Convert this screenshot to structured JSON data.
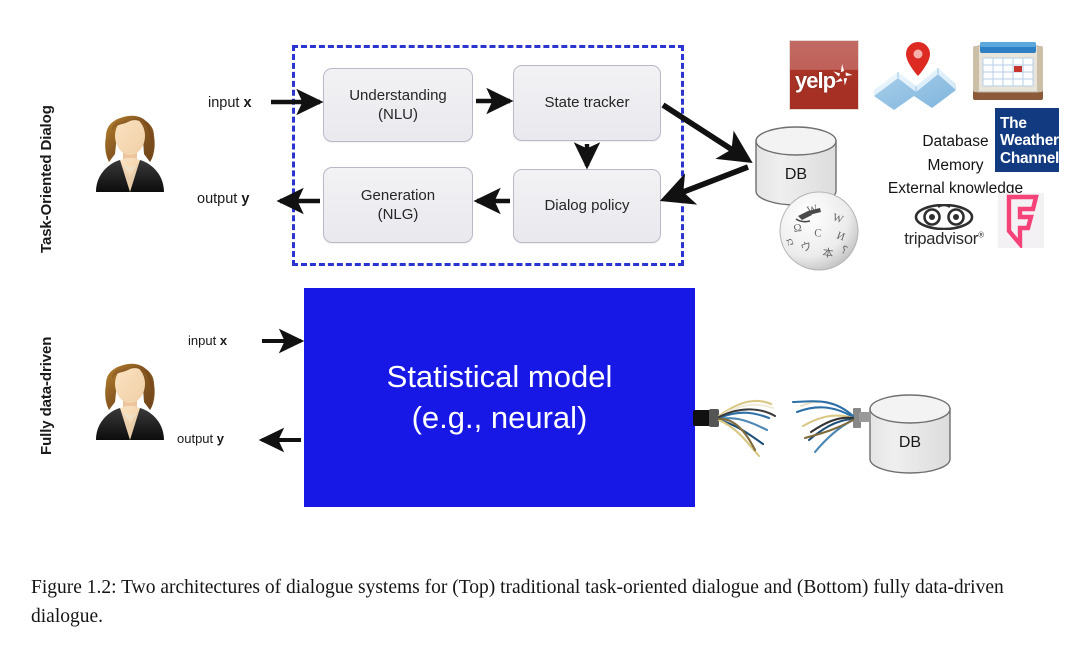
{
  "figure": {
    "rows": [
      {
        "label": "Task-Oriented Dialog",
        "name": "task-oriented-dialog-row"
      },
      {
        "label": "Fully data-driven",
        "name": "fully-data-driven-row"
      }
    ],
    "io": {
      "input_prefix": "input ",
      "input_var": "x",
      "output_prefix": "output ",
      "output_var": "y"
    },
    "pipeline": {
      "modules": [
        {
          "line1": "Understanding",
          "line2": "(NLU)"
        },
        {
          "line1": "State tracker",
          "line2": ""
        },
        {
          "line1": "Dialog policy",
          "line2": ""
        },
        {
          "line1": "Generation",
          "line2": "(NLG)"
        }
      ]
    },
    "model": {
      "line1": "Statistical model",
      "line2": "(e.g., neural)",
      "color": "#1717e6"
    },
    "db": {
      "top_label": "DB",
      "bottom_label": "DB"
    },
    "knowledge": {
      "lines": [
        "Database",
        "Memory",
        "External knowledge"
      ]
    },
    "logos": [
      {
        "name": "yelp-logo",
        "text": "yelp",
        "color": "#a52f23"
      },
      {
        "name": "maps-logo",
        "text": ""
      },
      {
        "name": "calendar-logo",
        "text": ""
      },
      {
        "name": "weather-channel-logo",
        "line1": "The",
        "line2": "Weather",
        "line3": "Channel",
        "color": "#123a80"
      },
      {
        "name": "wikipedia-logo",
        "text": ""
      },
      {
        "name": "tripadvisor-logo",
        "text": "tripadvisor",
        "registered": "®"
      },
      {
        "name": "foursquare-logo",
        "text": "",
        "color": "#f54278"
      }
    ],
    "dashed_border_color": "#2a36cf"
  },
  "caption": {
    "text": "Figure 1.2: Two architectures of dialogue systems for (Top) traditional task-oriented dialogue and (Bottom) fully data-driven dialogue."
  }
}
